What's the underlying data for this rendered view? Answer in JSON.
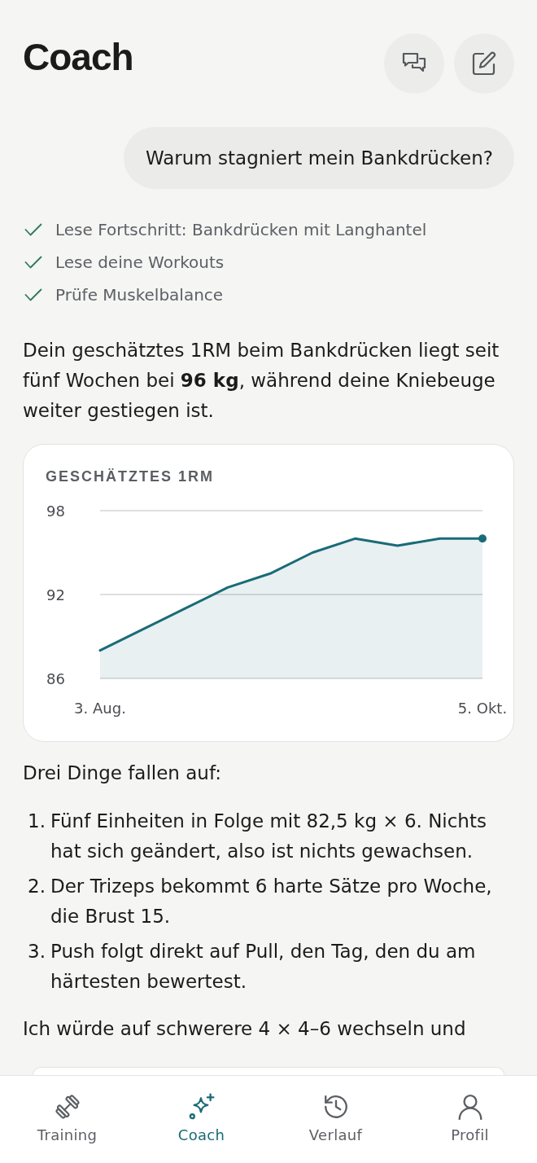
{
  "header": {
    "title": "Coach"
  },
  "user_message": {
    "text": "Warum stagniert mein Bankdrücken?"
  },
  "steps": [
    {
      "label": "Lese Fortschritt: Bankdrücken mit Langhantel",
      "done": true
    },
    {
      "label": "Lese deine Workouts",
      "done": true
    },
    {
      "label": "Prüfe Muskelbalance",
      "done": true
    }
  ],
  "answer": {
    "intro": "Dein geschätztes 1RM beim Bankdrücken liegt seit fünf Wochen bei **96 kg**, während deine Kniebeuge weiter gestiegen ist.",
    "chart": {
      "chart_data": {
        "type": "area",
        "title": "GESCHÄTZTES 1RM",
        "categories": [
          "3. Aug.",
          null,
          null,
          null,
          null,
          null,
          null,
          null,
          null,
          "5. Okt."
        ],
        "series": [
          {
            "color": "#1a6b78",
            "values": [
              88,
              89.5,
              91,
              92.5,
              93.5,
              95,
              96,
              95.5,
              96,
              96
            ]
          }
        ],
        "ylim": [
          86,
          98
        ],
        "yticks": [
          86,
          92,
          98
        ]
      }
    },
    "list_intro": "Drei Dinge fallen auf:",
    "points": [
      {
        "number": "1.",
        "text": "Fünf Einheiten in Folge mit 82,5 kg × 6. Nichts hat sich geändert, also ist nichts gewachsen."
      },
      {
        "number": "2.",
        "text": "Der Trizeps bekommt 6 harte Sätze pro Woche, die Brust 15."
      },
      {
        "number": "3.",
        "text": "Push folgt direkt auf Pull, den Tag, den du am härtesten bewertest."
      }
    ],
    "closing": "Ich würde auf schwerere 4 × 4–6 wechseln und"
  },
  "nav": {
    "items": [
      {
        "label": "Training",
        "selected": false
      },
      {
        "label": "Coach",
        "selected": true
      },
      {
        "label": "Verlauf",
        "selected": false
      },
      {
        "label": "Profil",
        "selected": false
      }
    ]
  }
}
